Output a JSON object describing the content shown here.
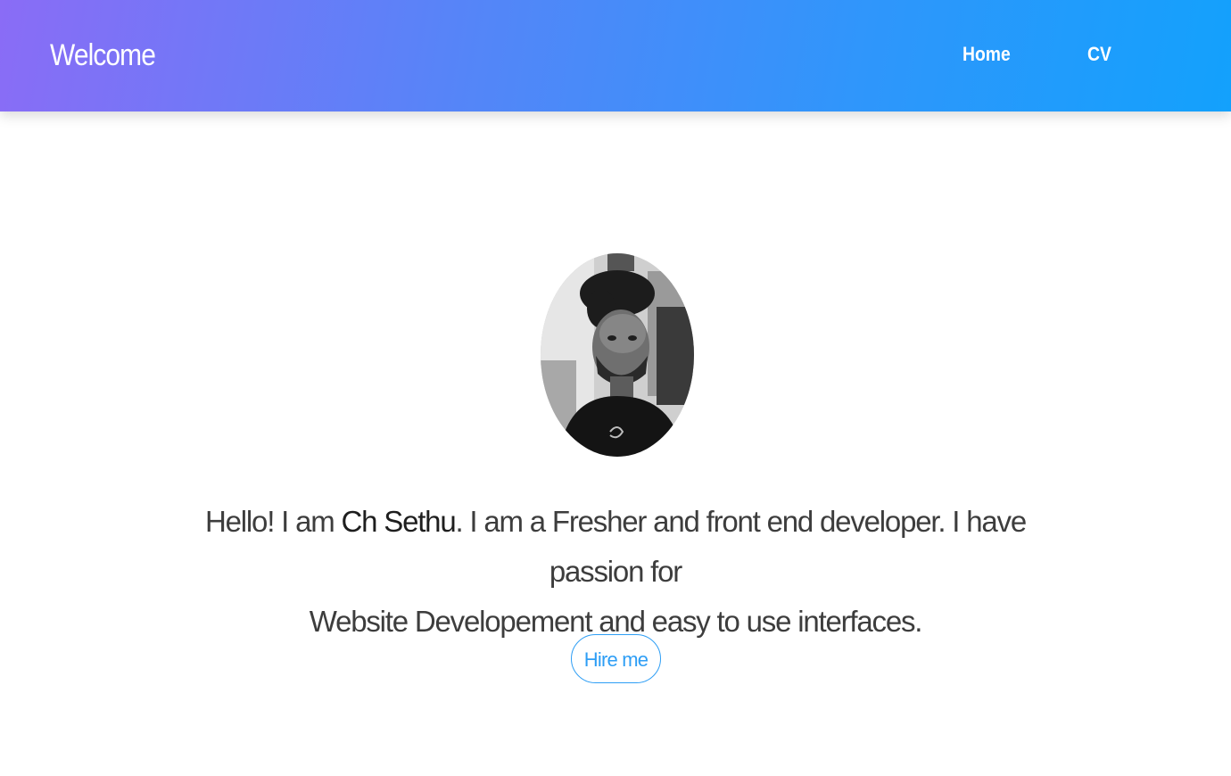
{
  "navbar": {
    "brand": "Welcome",
    "links": [
      {
        "label": "Home"
      },
      {
        "label": "CV"
      }
    ]
  },
  "hero": {
    "avatar_alt": "profile-photo",
    "intro_prefix": "Hello! I am ",
    "name": "Ch Sethu",
    "intro_line1_rest": ". I am a Fresher and front end developer. I have passion for",
    "intro_line2": "Website Developement and easy to use interfaces.",
    "cta_label": "Hire me"
  },
  "colors": {
    "gradient_start": "#8a6cf6",
    "gradient_end": "#13a1fc",
    "cta_accent": "#2e9ef5"
  }
}
